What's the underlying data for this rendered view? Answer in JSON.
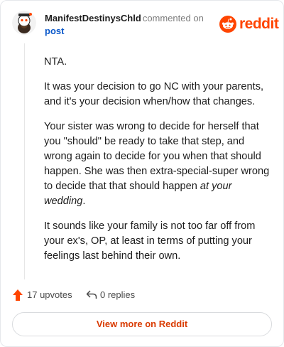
{
  "comment": {
    "username": "ManifestDestinysChld",
    "action_text": "commented on",
    "post_link": "post",
    "paragraphs": [
      "NTA.",
      "It was your decision to go NC with your parents, and it's your decision when/how that changes.",
      "Your sister was wrong to decide for herself that you \"should\" be ready to take that step, and wrong again to decide for you when that should happen. She was then extra-special-super wrong to decide that that should happen",
      "It sounds like your family is not too far off from your ex's, OP, at least in terms of putting your feelings last behind their own."
    ],
    "emphasis": "at your wedding",
    "period": "."
  },
  "brand": {
    "name": "reddit",
    "icon": "reddit-logo-icon",
    "color": "#ff4500"
  },
  "actions": {
    "upvotes_label": "17 upvotes",
    "upvote_icon": "upvote-arrow-icon",
    "replies_label": "0 replies",
    "reply_icon": "reply-arrow-icon"
  },
  "footer": {
    "view_more_label": "View more on Reddit"
  }
}
